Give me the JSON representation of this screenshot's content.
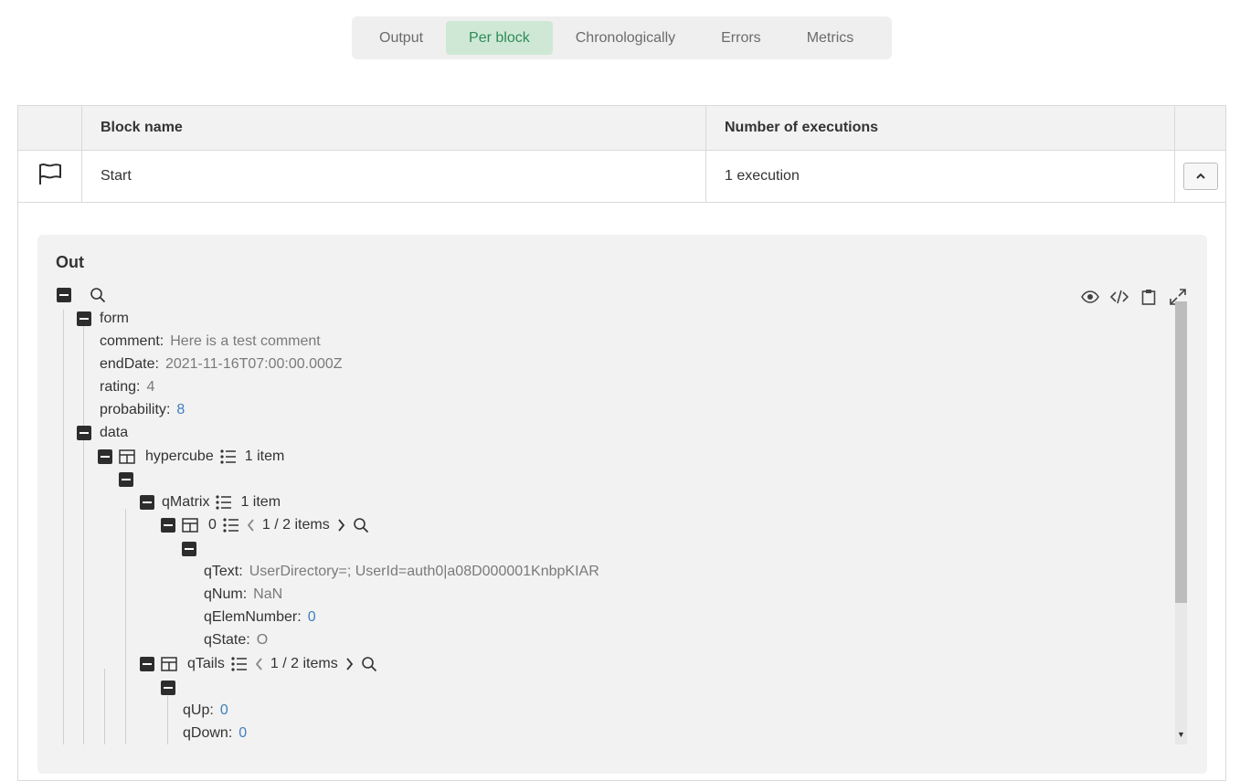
{
  "tabs": [
    {
      "label": "Output"
    },
    {
      "label": "Per block",
      "active": true
    },
    {
      "label": "Chronologically"
    },
    {
      "label": "Errors"
    },
    {
      "label": "Metrics"
    }
  ],
  "table": {
    "headers": {
      "block_name": "Block name",
      "executions": "Number of executions"
    },
    "row": {
      "icon": "flag-icon",
      "block_name": "Start",
      "executions": "1 execution"
    }
  },
  "panel": {
    "title": "Out",
    "tree": {
      "form": {
        "label": "form",
        "comment": {
          "key": "comment",
          "value": "Here is a test comment"
        },
        "endDate": {
          "key": "endDate",
          "value": "2021-11-16T07:00:00.000Z"
        },
        "rating": {
          "key": "rating",
          "value": "4"
        },
        "probability": {
          "key": "probability",
          "value": "8"
        }
      },
      "data": {
        "label": "data",
        "hypercube": {
          "label": "hypercube",
          "count": "1 item"
        },
        "qMatrix": {
          "label": "qMatrix",
          "count": "1 item"
        },
        "matrix0": {
          "label": "0",
          "pager": "1 / 2 items"
        },
        "qText": {
          "key": "qText",
          "value": "UserDirectory=; UserId=auth0|a08D000001KnbpKIAR"
        },
        "qNum": {
          "key": "qNum",
          "value": "NaN"
        },
        "qElemNumber": {
          "key": "qElemNumber",
          "value": "0"
        },
        "qState": {
          "key": "qState",
          "value": "O"
        },
        "qTails": {
          "label": "qTails",
          "pager": "1 / 2 items"
        },
        "qUp": {
          "key": "qUp",
          "value": "0"
        },
        "qDown": {
          "key": "qDown",
          "value": "0"
        }
      }
    }
  },
  "colors": {
    "accent": "#2e8b57",
    "active_tab_bg": "#cfe8d6",
    "number": "#3f7fbf",
    "string": "#7a7a7a"
  }
}
